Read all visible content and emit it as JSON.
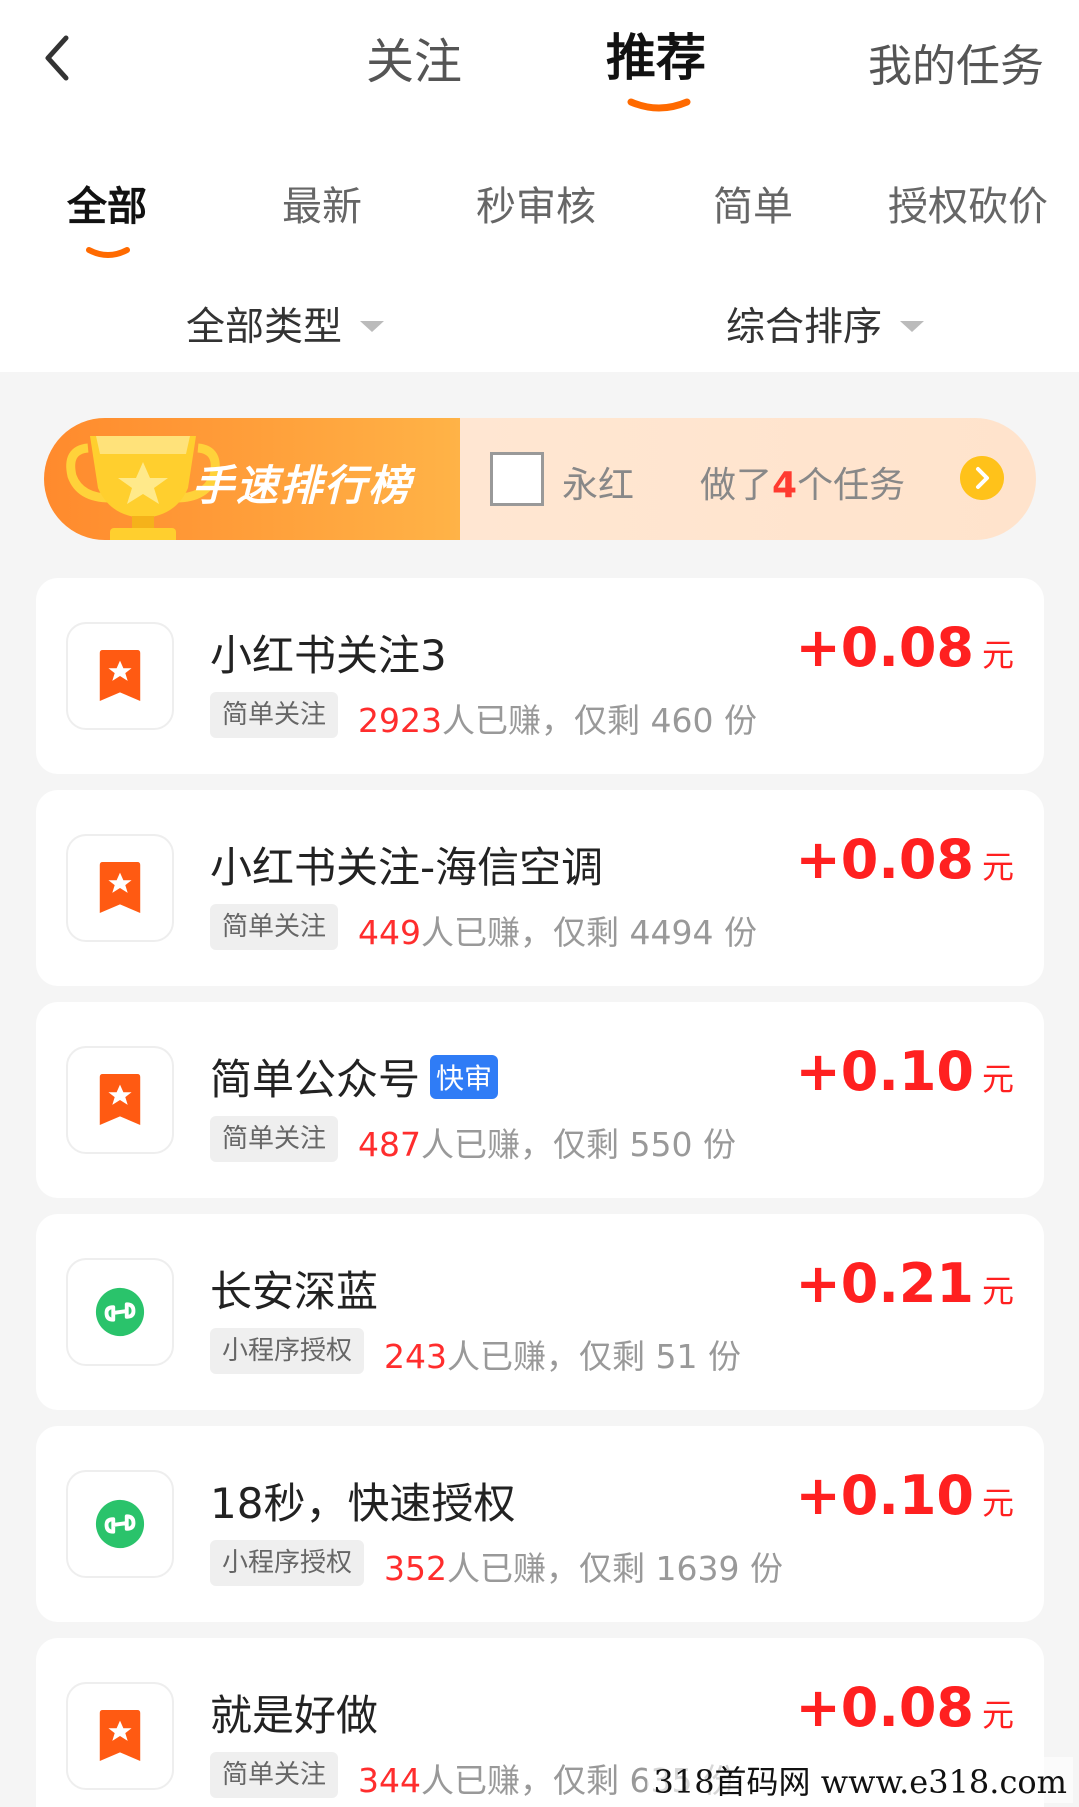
{
  "header": {
    "tabs": [
      {
        "label": "关注"
      },
      {
        "label": "推荐"
      },
      {
        "label": "我的任务"
      }
    ],
    "active_tab": "推荐"
  },
  "subtabs": [
    {
      "label": "全部"
    },
    {
      "label": "最新"
    },
    {
      "label": "秒审核"
    },
    {
      "label": "简单"
    },
    {
      "label": "授权砍价"
    }
  ],
  "filters": {
    "type_label": "全部类型",
    "sort_label": "综合排序"
  },
  "ranking": {
    "title": "手速排行榜",
    "user_name": "永红",
    "did_prefix": "做了",
    "did_count": "4",
    "did_suffix": "个任务"
  },
  "tasks": [
    {
      "title": "小红书关注3",
      "badge": "",
      "tag": "简单关注",
      "earned": "2923",
      "earned_suffix": "人已赚，",
      "remain_text": "仅剩 460 份",
      "price": "+0.08",
      "unit": "元",
      "icon": "bookmark-star-icon"
    },
    {
      "title": "小红书关注-海信空调",
      "badge": "",
      "tag": "简单关注",
      "earned": "449",
      "earned_suffix": "人已赚，",
      "remain_text": "仅剩 4494 份",
      "price": "+0.08",
      "unit": "元",
      "icon": "bookmark-star-icon"
    },
    {
      "title": "简单公众号",
      "badge": "快审",
      "tag": "简单关注",
      "earned": "487",
      "earned_suffix": "人已赚，",
      "remain_text": "仅剩 550 份",
      "price": "+0.10",
      "unit": "元",
      "icon": "bookmark-star-icon"
    },
    {
      "title": "长安深蓝",
      "badge": "",
      "tag": "小程序授权",
      "earned": "243",
      "earned_suffix": "人已赚，",
      "remain_text": "仅剩 51 份",
      "price": "+0.21",
      "unit": "元",
      "icon": "mini-program-icon"
    },
    {
      "title": "18秒，快速授权",
      "badge": "",
      "tag": "小程序授权",
      "earned": "352",
      "earned_suffix": "人已赚，",
      "remain_text": "仅剩 1639 份",
      "price": "+0.10",
      "unit": "元",
      "icon": "mini-program-icon"
    },
    {
      "title": "就是好做",
      "badge": "",
      "tag": "简单关注",
      "earned": "344",
      "earned_suffix": "人已赚，",
      "remain_text": "仅剩 635 份",
      "price": "+0.08",
      "unit": "元",
      "icon": "bookmark-star-icon"
    }
  ],
  "watermark": "318首码网  www.e318.com",
  "colors": {
    "accent": "#ff6a00",
    "price": "#ff2020",
    "earned": "#ff2d2d",
    "fast_badge": "#2f7cf6",
    "mini_program": "#2ac36b"
  }
}
